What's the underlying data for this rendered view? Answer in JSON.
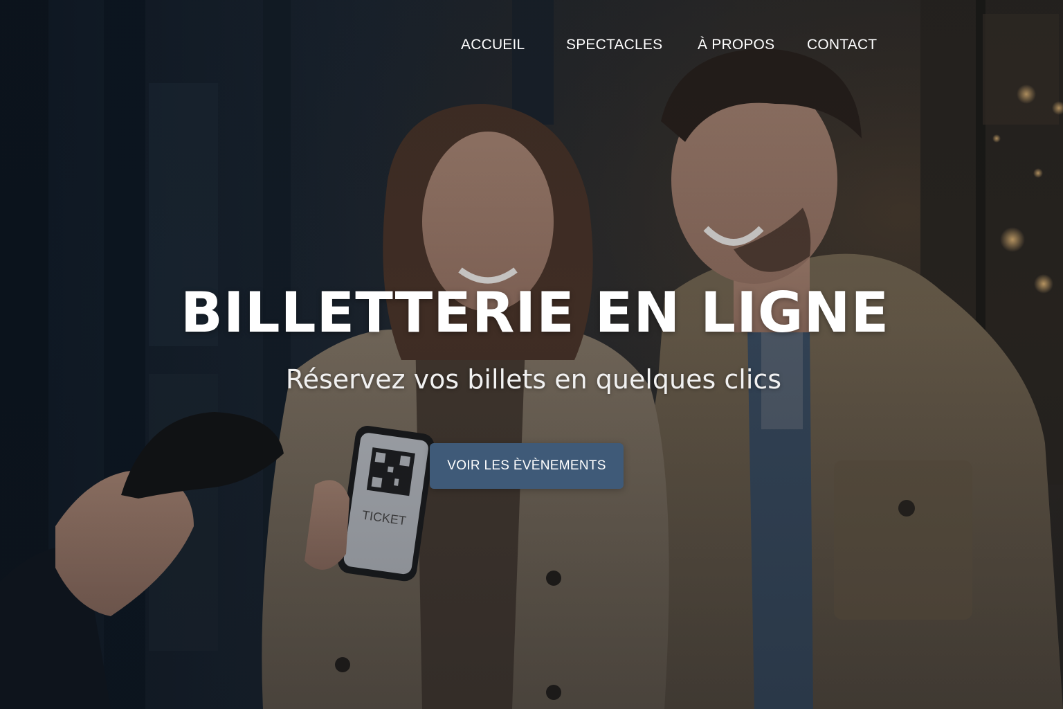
{
  "nav": {
    "items": [
      {
        "label": "ACCUEIL"
      },
      {
        "label": "SPECTACLES"
      },
      {
        "label": "À PROPOS"
      },
      {
        "label": "CONTACT"
      }
    ]
  },
  "hero": {
    "title": "BILLETTERIE EN LIGNE",
    "subtitle": "Réservez vos billets en quelques clics",
    "cta_label": "VOIR LES ÈVÈNEMENTS",
    "phone_ticket_text": "TICKET"
  },
  "colors": {
    "button_bg": "#3f5a78",
    "overlay": "#0f141c",
    "text": "#ffffff"
  }
}
